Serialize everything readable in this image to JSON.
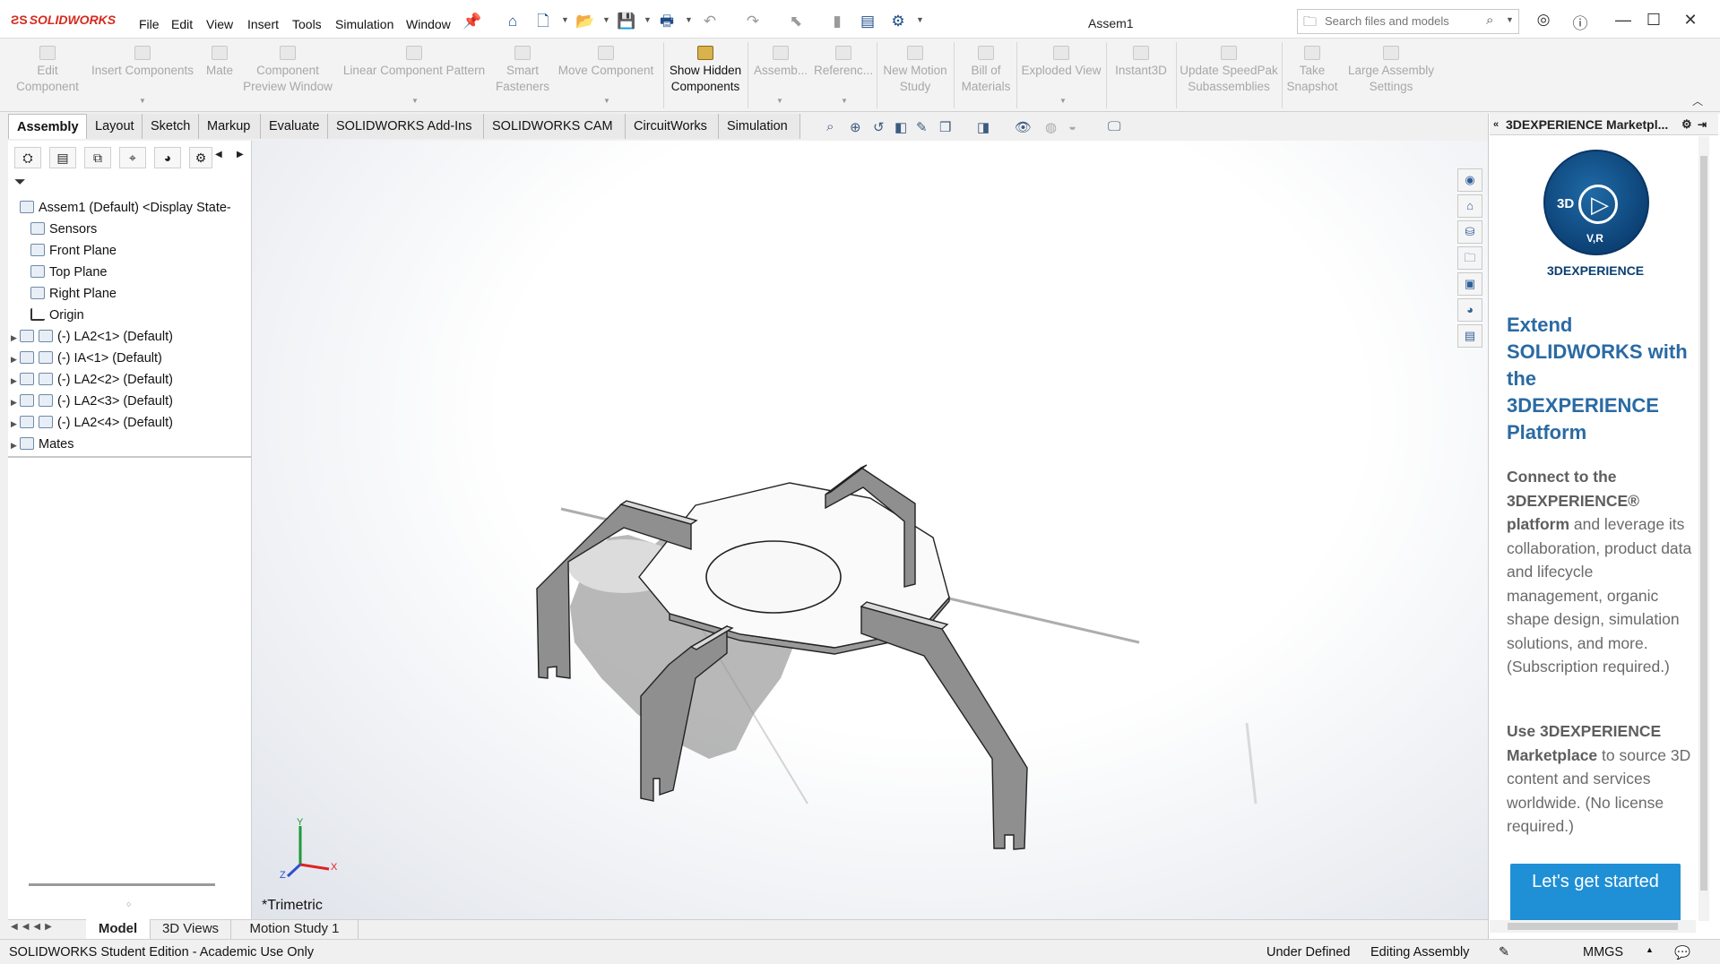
{
  "app": {
    "brand": "SOLIDWORKS",
    "document_title": "Assem1"
  },
  "menu": [
    "File",
    "Edit",
    "View",
    "Insert",
    "Tools",
    "Simulation",
    "Window"
  ],
  "search": {
    "placeholder": "Search files and models"
  },
  "commands": [
    {
      "label1": "Edit",
      "label2": "Component"
    },
    {
      "label1": "Insert Components",
      "label2": ""
    },
    {
      "label1": "Mate",
      "label2": ""
    },
    {
      "label1": "Component",
      "label2": "Preview Window"
    },
    {
      "label1": "Linear Component Pattern",
      "label2": ""
    },
    {
      "label1": "Smart",
      "label2": "Fasteners"
    },
    {
      "label1": "Move Component",
      "label2": ""
    },
    {
      "label1": "Show Hidden",
      "label2": "Components"
    },
    {
      "label1": "Assemb...",
      "label2": ""
    },
    {
      "label1": "Referenc...",
      "label2": ""
    },
    {
      "label1": "New Motion",
      "label2": "Study"
    },
    {
      "label1": "Bill of",
      "label2": "Materials"
    },
    {
      "label1": "Exploded View",
      "label2": ""
    },
    {
      "label1": "Instant3D",
      "label2": ""
    },
    {
      "label1": "Update SpeedPak",
      "label2": "Subassemblies"
    },
    {
      "label1": "Take",
      "label2": "Snapshot"
    },
    {
      "label1": "Large Assembly",
      "label2": "Settings"
    }
  ],
  "tabs": [
    "Assembly",
    "Layout",
    "Sketch",
    "Markup",
    "Evaluate",
    "SOLIDWORKS Add-Ins",
    "SOLIDWORKS CAM",
    "CircuitWorks",
    "Simulation"
  ],
  "tree": {
    "root": "Assem1 (Default) <Display State-",
    "items": [
      "Sensors",
      "Front Plane",
      "Top Plane",
      "Right Plane",
      "Origin"
    ],
    "components": [
      "(-) LA2<1> (Default)",
      "(-) IA<1> (Default)",
      "(-) LA2<2> (Default)",
      "(-) LA2<3> (Default)",
      "(-) LA2<4> (Default)"
    ],
    "mates": "Mates"
  },
  "viewport": {
    "view_label": "*Trimetric",
    "triad_x": "X",
    "triad_y": "Y",
    "triad_z": "Z"
  },
  "taskpane": {
    "title": "3DEXPERIENCE Marketpl...",
    "logo_text": "3DEXPERIENCE",
    "logo_3d": "3D",
    "logo_vr": "V,R",
    "heading": "Extend SOLIDWORKS with the 3DEXPERIENCE Platform",
    "p1_bold": "Connect to the 3DEXPERIENCE® platform",
    "p1_rest": " and leverage its collaboration, product data and lifecycle management, organic shape design, simulation solutions, and more. (Subscription required.)",
    "p2_bold": "Use 3DEXPERIENCE Marketplace",
    "p2_rest": " to source 3D content and services worldwide. (No license required.)",
    "button": "Let's get started"
  },
  "bottom_tabs": [
    "Model",
    "3D Views",
    "Motion Study 1"
  ],
  "status": {
    "left": "SOLIDWORKS Student Edition - Academic Use Only",
    "state": "Under Defined",
    "mode": "Editing Assembly",
    "units": "MMGS"
  }
}
